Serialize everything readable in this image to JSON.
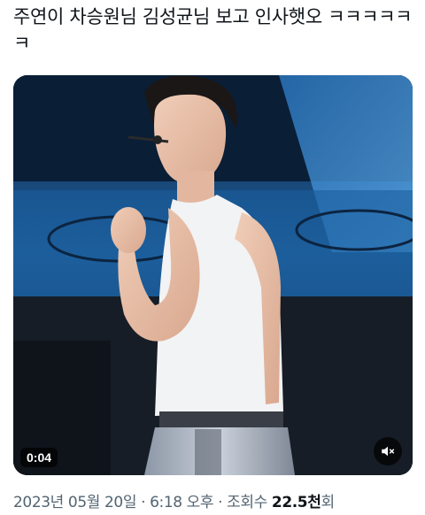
{
  "post": {
    "text": "주연이 차승원님 김성균님 보고 인사햇오 ㅋㅋㅋㅋㅋㅋ"
  },
  "video": {
    "timestamp": "0:04",
    "mute_icon": "speaker-muted-icon"
  },
  "meta": {
    "date": "2023년 05월 20일",
    "separator1": " · ",
    "time": "6:18 오후",
    "separator2": " · ",
    "views_label": "조회수 ",
    "views_count": "22.5천",
    "views_suffix": "회"
  },
  "colors": {
    "text_primary": "#0f1419",
    "text_secondary": "#536471",
    "badge_bg": "#000000"
  }
}
